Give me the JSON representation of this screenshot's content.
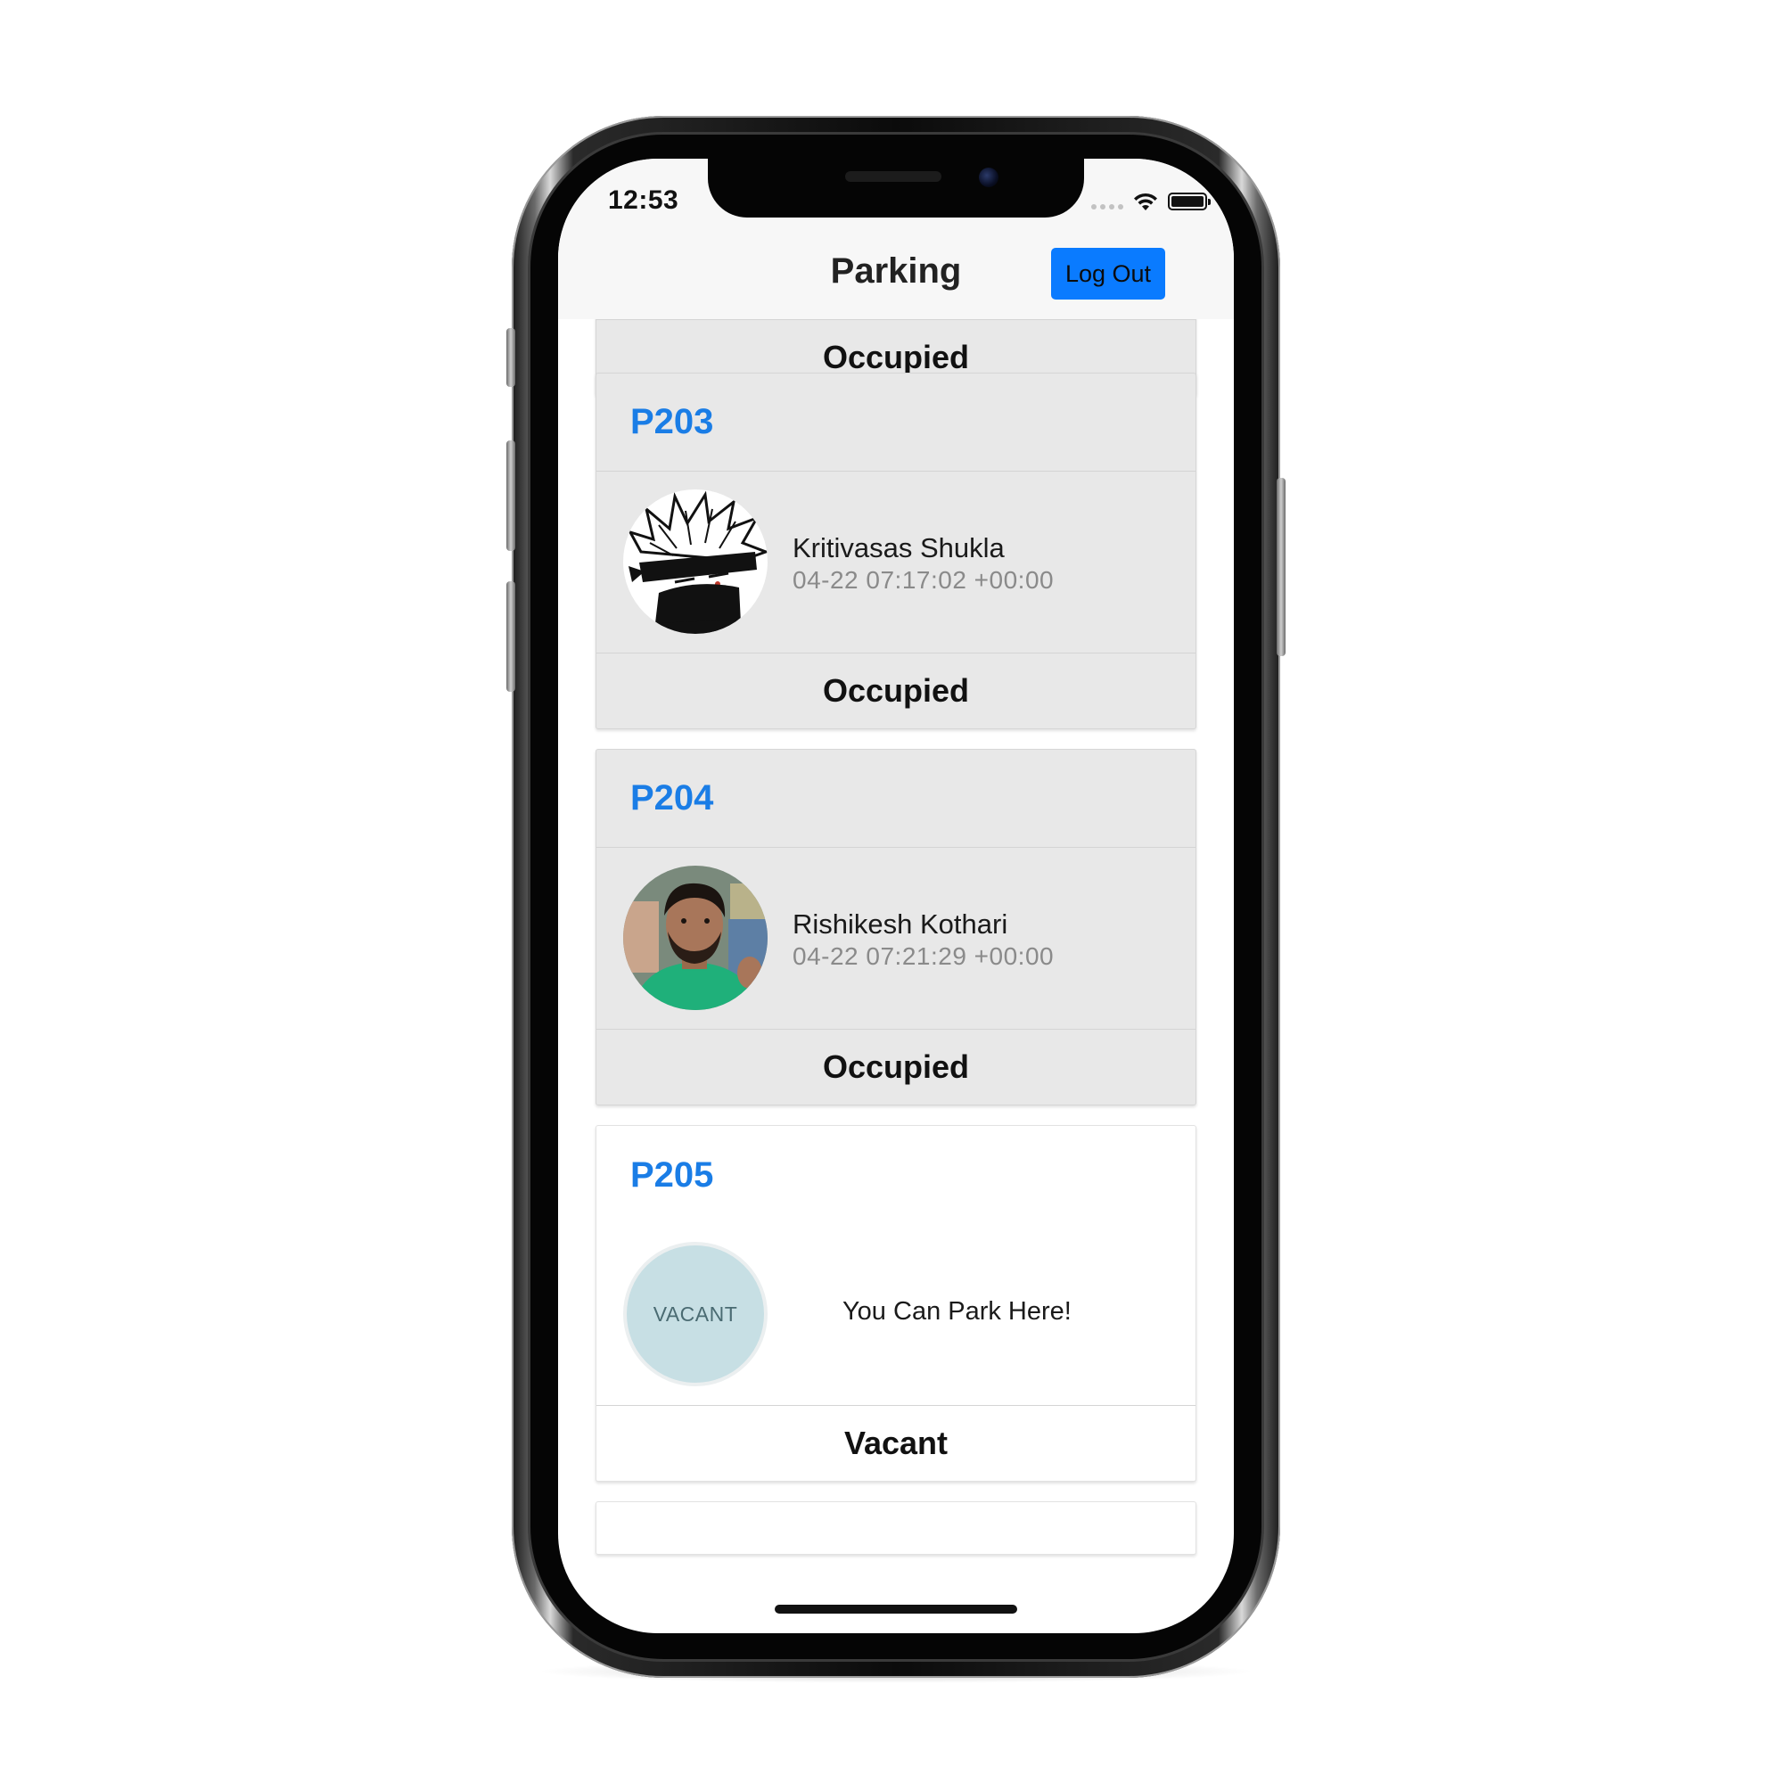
{
  "status_bar": {
    "time": "12:53"
  },
  "navbar": {
    "title": "Parking",
    "logout_label": "Log Out"
  },
  "slots": [
    {
      "id": "",
      "status": "Occupied"
    },
    {
      "id": "P203",
      "driver_name": "Kritivasas Shukla",
      "time": "04-22 07:17:02 +00:00",
      "status": "Occupied"
    },
    {
      "id": "P204",
      "driver_name": "Rishikesh Kothari",
      "time": "04-22 07:21:29 +00:00",
      "status": "Occupied"
    },
    {
      "id": "P205",
      "avatar_text": "VACANT",
      "message": "You Can Park Here!",
      "status": "Vacant"
    }
  ],
  "colors": {
    "accent": "#0a7bff",
    "slot_title": "#1a7de6",
    "occupied_card_bg": "#e8e8e8",
    "vacant_card_bg": "#ffffff",
    "vacant_avatar_bg": "#c7dfe4"
  },
  "icons": {
    "wifi": "wifi-icon",
    "battery": "battery-icon",
    "signal": "cellular-signal-icon"
  }
}
